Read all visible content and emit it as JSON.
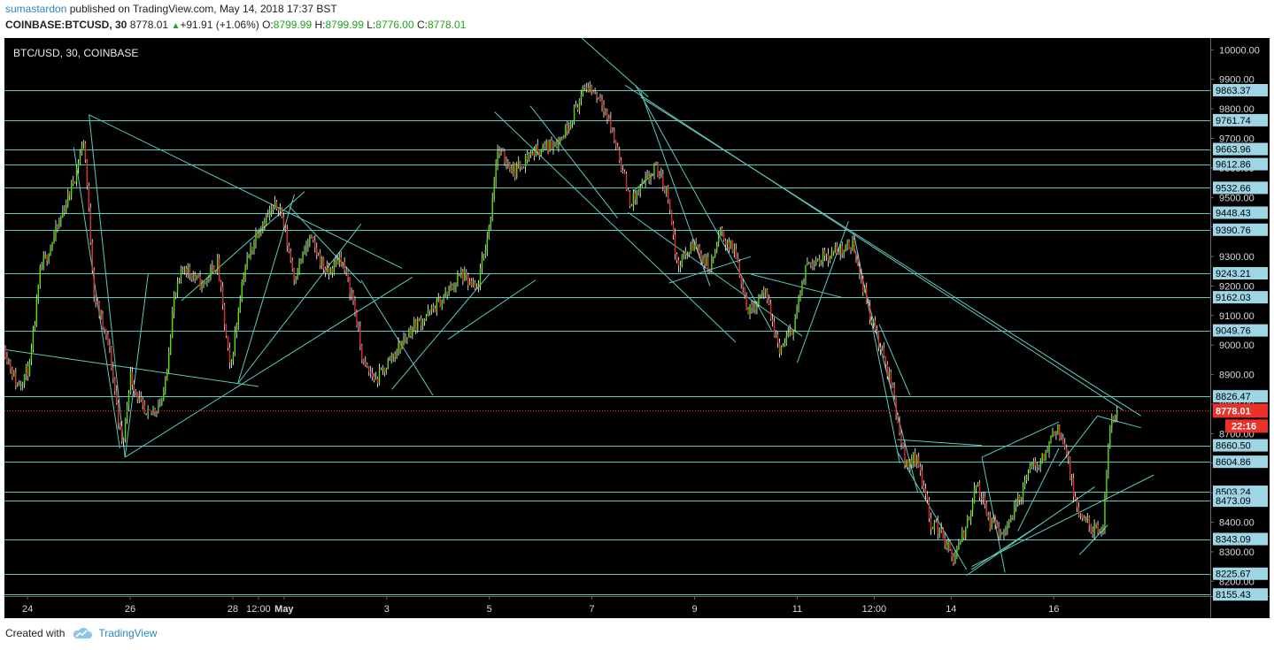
{
  "header": {
    "publisher": "sumastardon",
    "published_text": "published on TradingView.com, May 14, 2018 17:37 BST",
    "symbol": "COINBASE:BTCUSD, 30",
    "last": "8778.01",
    "change": "+91.91 (+1.06%)",
    "o_label": "O:",
    "o": "8799.99",
    "h_label": "H:",
    "h": "8799.99",
    "l_label": "L:",
    "l": "8776.00",
    "c_label": "C:",
    "c": "8778.01"
  },
  "footer": {
    "created_with": "Created with",
    "brand": "TradingView"
  },
  "colors": {
    "up": "#55e000",
    "down": "#e0302a",
    "line": "#5fc9bb",
    "bg": "#000000",
    "price_tag": "#e8322a",
    "label_bg": "#9fd6e6"
  },
  "chart_data": {
    "type": "candlestick",
    "title": "BTC/USD, 30, COINBASE",
    "y_range": [
      8150,
      10040
    ],
    "y_ticks": [
      8200,
      8300,
      8400,
      8500,
      8600,
      8700,
      8800,
      8900,
      9000,
      9100,
      9200,
      9300,
      9400,
      9500,
      9600,
      9700,
      9800,
      9900,
      10000
    ],
    "x_ticks": [
      {
        "label": "24",
        "x": 0.5
      },
      {
        "label": "26",
        "x": 2.5
      },
      {
        "label": "28",
        "x": 4.5
      },
      {
        "label": "12:00",
        "x": 5.0
      },
      {
        "label": "May",
        "x": 5.5
      },
      {
        "label": "3",
        "x": 7.5
      },
      {
        "label": "5",
        "x": 9.5
      },
      {
        "label": "7",
        "x": 11.5
      },
      {
        "label": "9",
        "x": 13.5
      },
      {
        "label": "11",
        "x": 15.5
      },
      {
        "label": "12:00",
        "x": 17.0
      },
      {
        "label": "14",
        "x": 18.5
      },
      {
        "label": "16",
        "x": 20.5
      }
    ],
    "x_range": [
      0.05,
      23.55
    ],
    "levels": [
      9863.37,
      9761.74,
      9663.96,
      9612.86,
      9532.66,
      9448.43,
      9390.76,
      9243.21,
      9162.03,
      9049.76,
      8826.47,
      8660.5,
      8604.86,
      8503.24,
      8473.09,
      8343.09,
      8225.67,
      8155.43
    ],
    "last_price": 8778.01,
    "countdown": "22:16",
    "price_path": [
      [
        0.05,
        8990
      ],
      [
        0.3,
        8860
      ],
      [
        0.55,
        8930
      ],
      [
        0.75,
        9250
      ],
      [
        1.05,
        9380
      ],
      [
        1.4,
        9560
      ],
      [
        1.6,
        9700
      ],
      [
        1.8,
        9170
      ],
      [
        2.1,
        8980
      ],
      [
        2.35,
        8650
      ],
      [
        2.5,
        8900
      ],
      [
        2.8,
        8750
      ],
      [
        3.15,
        8820
      ],
      [
        3.35,
        9150
      ],
      [
        3.55,
        9270
      ],
      [
        3.9,
        9200
      ],
      [
        4.2,
        9280
      ],
      [
        4.45,
        8910
      ],
      [
        4.7,
        9240
      ],
      [
        5.0,
        9400
      ],
      [
        5.4,
        9480
      ],
      [
        5.7,
        9230
      ],
      [
        6.0,
        9360
      ],
      [
        6.35,
        9240
      ],
      [
        6.6,
        9300
      ],
      [
        6.85,
        9150
      ],
      [
        7.05,
        8930
      ],
      [
        7.3,
        8880
      ],
      [
        7.6,
        8960
      ],
      [
        8.0,
        9060
      ],
      [
        8.35,
        9110
      ],
      [
        8.7,
        9180
      ],
      [
        8.95,
        9240
      ],
      [
        9.25,
        9180
      ],
      [
        9.5,
        9400
      ],
      [
        9.65,
        9660
      ],
      [
        10.0,
        9590
      ],
      [
        10.3,
        9650
      ],
      [
        10.7,
        9680
      ],
      [
        10.9,
        9700
      ],
      [
        11.15,
        9790
      ],
      [
        11.4,
        9880
      ],
      [
        11.7,
        9830
      ],
      [
        12.0,
        9660
      ],
      [
        12.25,
        9480
      ],
      [
        12.5,
        9540
      ],
      [
        12.75,
        9600
      ],
      [
        13.0,
        9500
      ],
      [
        13.15,
        9270
      ],
      [
        13.5,
        9340
      ],
      [
        13.8,
        9260
      ],
      [
        14.0,
        9380
      ],
      [
        14.3,
        9310
      ],
      [
        14.55,
        9110
      ],
      [
        14.85,
        9190
      ],
      [
        15.15,
        8980
      ],
      [
        15.4,
        9050
      ],
      [
        15.7,
        9280
      ],
      [
        16.0,
        9300
      ],
      [
        16.3,
        9320
      ],
      [
        16.6,
        9340
      ],
      [
        16.85,
        9150
      ],
      [
        17.1,
        9000
      ],
      [
        17.35,
        8860
      ],
      [
        17.6,
        8600
      ],
      [
        17.85,
        8620
      ],
      [
        18.1,
        8400
      ],
      [
        18.3,
        8370
      ],
      [
        18.55,
        8270
      ],
      [
        18.75,
        8360
      ],
      [
        19.0,
        8530
      ],
      [
        19.25,
        8400
      ],
      [
        19.5,
        8360
      ],
      [
        19.75,
        8450
      ],
      [
        20.05,
        8580
      ],
      [
        20.3,
        8620
      ],
      [
        20.55,
        8730
      ],
      [
        20.75,
        8630
      ],
      [
        20.95,
        8430
      ],
      [
        21.2,
        8390
      ],
      [
        21.45,
        8350
      ],
      [
        21.6,
        8740
      ],
      [
        21.75,
        8790
      ]
    ],
    "trendlines": [
      [
        [
          0.05,
          8985
        ],
        [
          5.0,
          8860
        ]
      ],
      [
        [
          1.7,
          9780
        ],
        [
          7.8,
          9260
        ]
      ],
      [
        [
          1.7,
          9780
        ],
        [
          2.4,
          8620
        ]
      ],
      [
        [
          2.4,
          8620
        ],
        [
          8.0,
          9230
        ]
      ],
      [
        [
          1.4,
          9670
        ],
        [
          2.3,
          8650
        ]
      ],
      [
        [
          2.4,
          8620
        ],
        [
          2.85,
          9240
        ]
      ],
      [
        [
          3.5,
          9150
        ],
        [
          5.9,
          9520
        ]
      ],
      [
        [
          4.6,
          8870
        ],
        [
          5.7,
          9510
        ]
      ],
      [
        [
          4.6,
          8870
        ],
        [
          7.0,
          9410
        ]
      ],
      [
        [
          5.6,
          9470
        ],
        [
          7.0,
          9210
        ]
      ],
      [
        [
          7.0,
          9220
        ],
        [
          8.4,
          8830
        ]
      ],
      [
        [
          7.6,
          8850
        ],
        [
          9.5,
          9240
        ]
      ],
      [
        [
          8.7,
          9020
        ],
        [
          10.4,
          9220
        ]
      ],
      [
        [
          9.6,
          9790
        ],
        [
          14.3,
          9010
        ]
      ],
      [
        [
          10.3,
          9810
        ],
        [
          12.0,
          9430
        ]
      ],
      [
        [
          11.3,
          10040
        ],
        [
          12.6,
          9840
        ]
      ],
      [
        [
          12.3,
          9520
        ],
        [
          12.7,
          9580
        ]
      ],
      [
        [
          12.2,
          9450
        ],
        [
          15.6,
          9030
        ]
      ],
      [
        [
          12.35,
          9880
        ],
        [
          15.0,
          9050
        ]
      ],
      [
        [
          12.45,
          9860
        ],
        [
          13.8,
          9200
        ]
      ],
      [
        [
          13.0,
          9210
        ],
        [
          14.6,
          9300
        ]
      ],
      [
        [
          14.6,
          9240
        ],
        [
          16.4,
          9160
        ]
      ],
      [
        [
          15.5,
          8940
        ],
        [
          16.5,
          9420
        ]
      ],
      [
        [
          16.6,
          9340
        ],
        [
          17.85,
          8500
        ]
      ],
      [
        [
          17.45,
          8640
        ],
        [
          18.8,
          8240
        ]
      ],
      [
        [
          12.15,
          9880
        ],
        [
          21.85,
          8780
        ]
      ],
      [
        [
          12.45,
          9840
        ],
        [
          22.2,
          8760
        ]
      ],
      [
        [
          17.1,
          9070
        ],
        [
          17.7,
          8830
        ]
      ],
      [
        [
          17.45,
          8680
        ],
        [
          19.1,
          8660
        ]
      ],
      [
        [
          18.8,
          8220
        ],
        [
          21.3,
          8520
        ]
      ],
      [
        [
          18.9,
          8250
        ],
        [
          22.45,
          8560
        ]
      ],
      [
        [
          18.9,
          8240
        ],
        [
          20.3,
          8400
        ]
      ],
      [
        [
          19.1,
          8620
        ],
        [
          19.55,
          8230
        ]
      ],
      [
        [
          19.1,
          8620
        ],
        [
          20.6,
          8740
        ]
      ],
      [
        [
          19.8,
          8370
        ],
        [
          20.6,
          8650
        ]
      ],
      [
        [
          20.6,
          8590
        ],
        [
          21.35,
          8760
        ]
      ],
      [
        [
          21.0,
          8290
        ],
        [
          21.55,
          8390
        ]
      ],
      [
        [
          21.35,
          8760
        ],
        [
          22.2,
          8720
        ]
      ],
      [
        [
          16.6,
          9380
        ],
        [
          17.5,
          8600
        ]
      ]
    ]
  }
}
